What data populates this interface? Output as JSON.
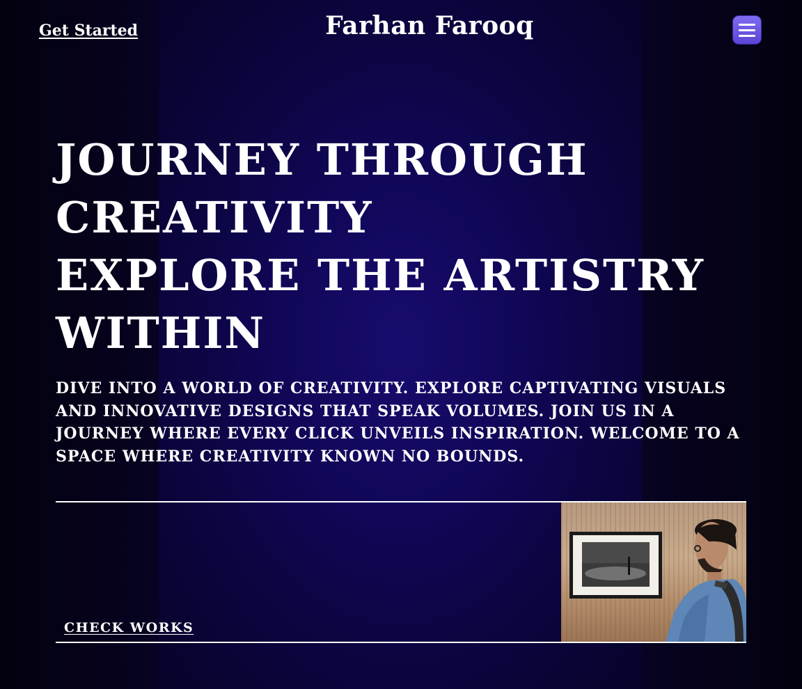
{
  "header": {
    "get_started_label": "Get Started",
    "brand": "Farhan Farooq",
    "menu_icon": "hamburger-menu-icon"
  },
  "hero": {
    "title_lines": [
      "JOURNEY THROUGH",
      "CREATIVITY",
      "EXPLORE THE ARTISTRY",
      "WITHIN"
    ],
    "description": "DIVE INTO A WORLD OF CREATIVITY. EXPLORE CAPTIVATING VISUALS AND INNOVATIVE DESIGNS THAT SPEAK VOLUMES. JOIN US IN A JOURNEY WHERE EVERY CLICK UNVEILS INSPIRATION. WELCOME TO A SPACE WHERE CREATIVITY KNOWN NO BOUNDS."
  },
  "works": {
    "check_works_label": "CHECK WORKS"
  },
  "colors": {
    "background": "#05021a",
    "glow": "#170c6e",
    "accent": "#5a45d6",
    "text": "#ffffff"
  }
}
